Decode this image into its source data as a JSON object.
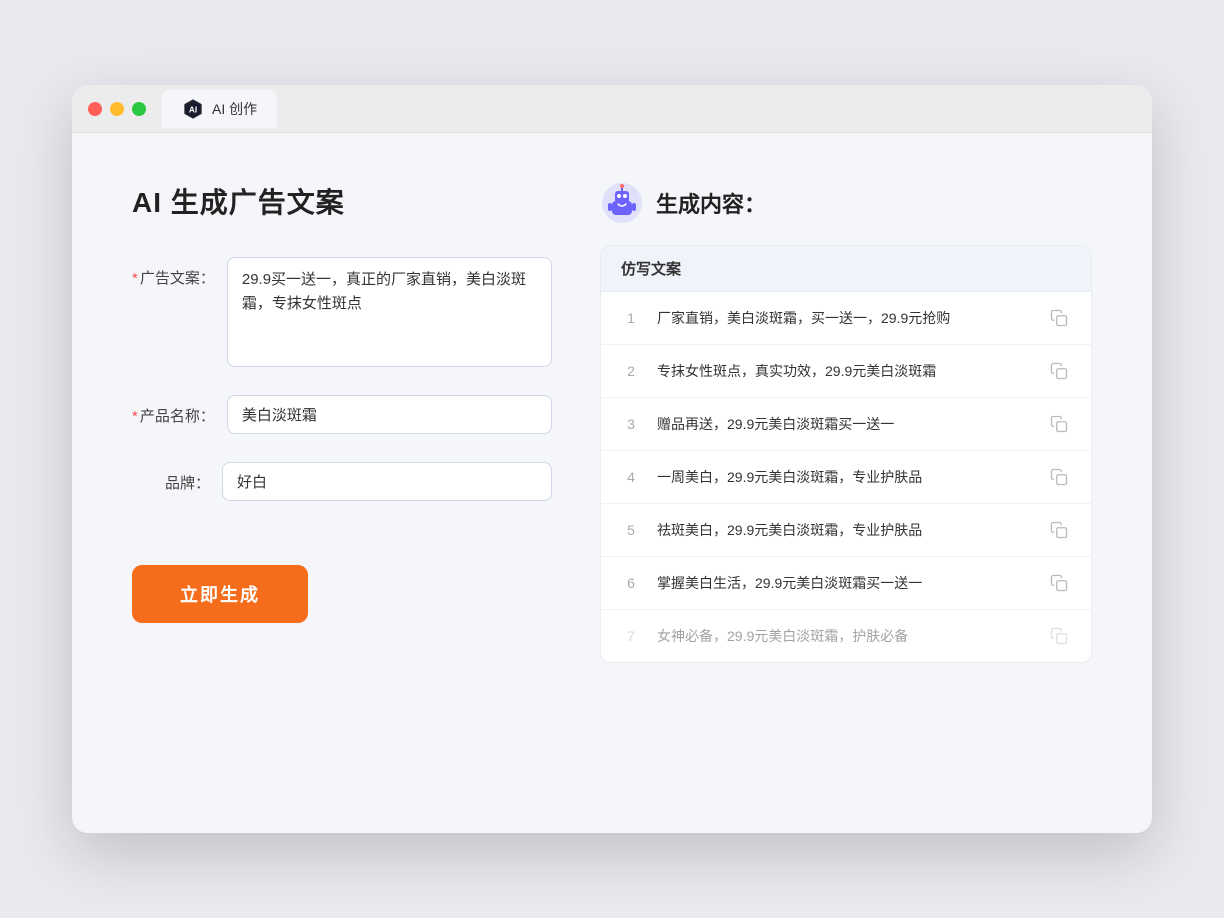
{
  "window": {
    "tab_label": "AI 创作"
  },
  "page": {
    "title": "AI 生成广告文案"
  },
  "form": {
    "ad_copy_label": "广告文案：",
    "ad_copy_required": true,
    "ad_copy_value": "29.9买一送一，真正的厂家直销，美白淡斑霜，专抹女性斑点",
    "product_name_label": "产品名称：",
    "product_name_required": true,
    "product_name_value": "美白淡斑霜",
    "brand_label": "品牌：",
    "brand_required": false,
    "brand_value": "好白",
    "generate_button": "立即生成"
  },
  "result": {
    "header": "生成内容：",
    "table_header": "仿写文案",
    "rows": [
      {
        "id": 1,
        "text": "厂家直销，美白淡斑霜，买一送一，29.9元抢购",
        "muted": false
      },
      {
        "id": 2,
        "text": "专抹女性斑点，真实功效，29.9元美白淡斑霜",
        "muted": false
      },
      {
        "id": 3,
        "text": "赠品再送，29.9元美白淡斑霜买一送一",
        "muted": false
      },
      {
        "id": 4,
        "text": "一周美白，29.9元美白淡斑霜，专业护肤品",
        "muted": false
      },
      {
        "id": 5,
        "text": "祛斑美白，29.9元美白淡斑霜，专业护肤品",
        "muted": false
      },
      {
        "id": 6,
        "text": "掌握美白生活，29.9元美白淡斑霜买一送一",
        "muted": false
      },
      {
        "id": 7,
        "text": "女神必备，29.9元美白淡斑霜，护肤必备",
        "muted": true
      }
    ]
  }
}
